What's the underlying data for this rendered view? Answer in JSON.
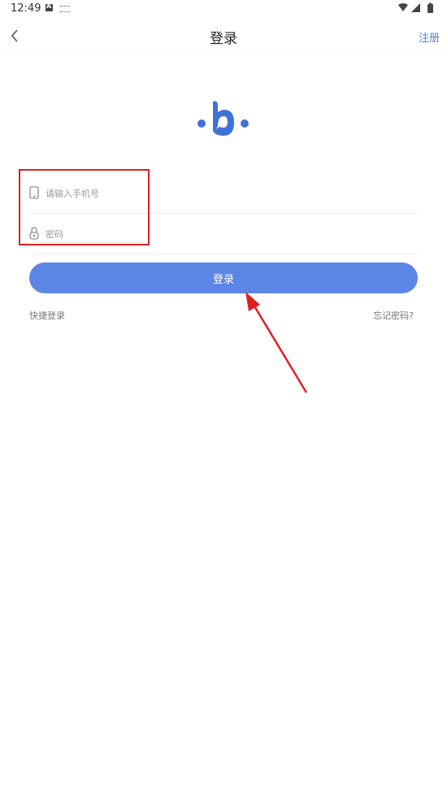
{
  "status_bar": {
    "time": "12:49",
    "icons": [
      "a-badge-icon",
      "keyboard-icon",
      "wifi-icon",
      "signal-icon",
      "battery-icon"
    ]
  },
  "header": {
    "title": "登录",
    "register_label": "注册",
    "back_icon": "chevron-left-icon"
  },
  "logo": {
    "glyph": "b",
    "color": "#3f72d8"
  },
  "form": {
    "phone": {
      "placeholder": "请输入手机号",
      "value": "",
      "icon": "phone-icon"
    },
    "password": {
      "placeholder": "密码",
      "value": "",
      "icon": "lock-icon"
    },
    "login_label": "登录",
    "quick_login_label": "快捷登录",
    "forgot_label": "忘记密码?"
  },
  "colors": {
    "accent": "#5b86e5",
    "link": "#4a7fdc",
    "annotation": "#e02020"
  }
}
